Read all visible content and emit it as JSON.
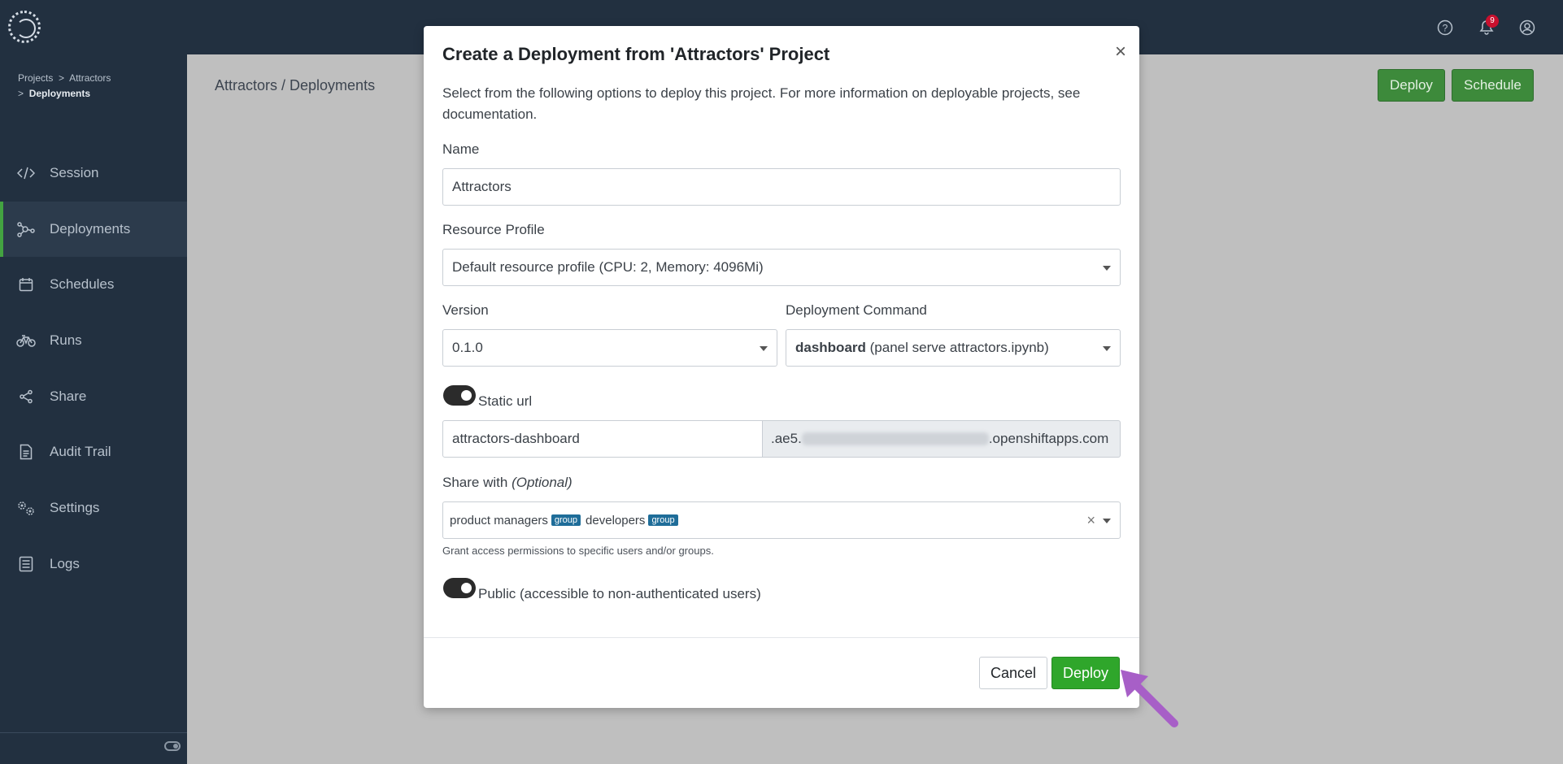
{
  "topbar": {
    "icons": [
      "help-icon",
      "bell-icon",
      "user-icon"
    ],
    "notification_count": "9"
  },
  "sidebar": {
    "breadcrumb": {
      "projects": "Projects",
      "sep": ">",
      "project": "Attractors",
      "current": "Deployments"
    },
    "items": [
      {
        "label": "Session",
        "icon": "code-icon"
      },
      {
        "label": "Deployments",
        "icon": "deployments-icon",
        "active": true
      },
      {
        "label": "Schedules",
        "icon": "calendar-icon"
      },
      {
        "label": "Runs",
        "icon": "bike-icon"
      },
      {
        "label": "Share",
        "icon": "share-icon"
      },
      {
        "label": "Audit Trail",
        "icon": "document-icon"
      },
      {
        "label": "Settings",
        "icon": "gears-icon"
      },
      {
        "label": "Logs",
        "icon": "logs-icon"
      }
    ]
  },
  "main": {
    "breadcrumb": "Attractors / Deployments",
    "deploy_label": "Deploy",
    "schedule_label": "Schedule"
  },
  "modal": {
    "title": "Create a Deployment from 'Attractors' Project",
    "close": "×",
    "description": "Select from the following options to deploy this project. For more information on deployable projects, see documentation.",
    "name_label": "Name",
    "name_value": "Attractors",
    "resource_label": "Resource Profile",
    "resource_value": "Default resource profile (CPU: 2, Memory: 4096Mi)",
    "version_label": "Version",
    "version_value": "0.1.0",
    "command_label": "Deployment Command",
    "command_name": "dashboard",
    "command_detail": "(panel serve attractors.ipynb)",
    "static_url_label": "Static url",
    "static_url_value": "attractors-dashboard",
    "domain_prefix": ".ae5.",
    "domain_suffix": ".openshiftapps.com",
    "share_label": "Share with",
    "share_optional": "(Optional)",
    "share_chips": [
      {
        "name": "product managers",
        "tag": "group"
      },
      {
        "name": "developers",
        "tag": "group"
      }
    ],
    "share_clear": "×",
    "share_help": "Grant access permissions to specific users and/or groups.",
    "public_label": "Public (accessible to non-authenticated users)",
    "cancel_label": "Cancel",
    "deploy_label": "Deploy"
  },
  "colors": {
    "accent": "#2fa62b",
    "sidebar": "#223040",
    "arrow": "#a75fc7"
  }
}
